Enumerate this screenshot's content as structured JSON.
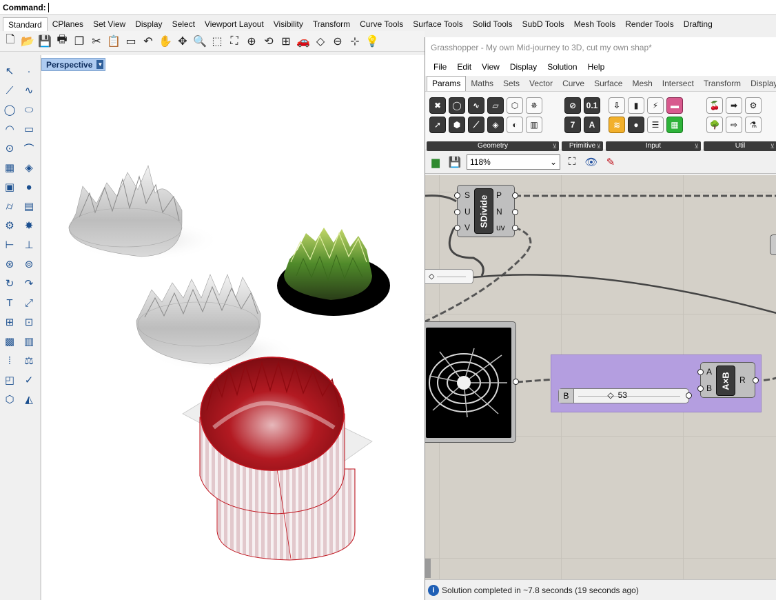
{
  "command": {
    "label": "Command:"
  },
  "tabs": [
    "Standard",
    "CPlanes",
    "Set View",
    "Display",
    "Select",
    "Viewport Layout",
    "Visibility",
    "Transform",
    "Curve Tools",
    "Surface Tools",
    "Solid Tools",
    "SubD Tools",
    "Mesh Tools",
    "Render Tools",
    "Drafting"
  ],
  "active_tab": "Standard",
  "viewport": {
    "name": "Perspective"
  },
  "grasshopper": {
    "title": "Grasshopper - My own Mid-journey to 3D, cut my own shap*",
    "menu": [
      "File",
      "Edit",
      "View",
      "Display",
      "Solution",
      "Help"
    ],
    "ribbon_tabs": [
      "Params",
      "Maths",
      "Sets",
      "Vector",
      "Curve",
      "Surface",
      "Mesh",
      "Intersect",
      "Transform",
      "Display"
    ],
    "active_ribbon_tab": "Params",
    "ribbon_groups": [
      {
        "label": "Geometry"
      },
      {
        "label": "Primitive"
      },
      {
        "label": "Input"
      },
      {
        "label": "Util"
      }
    ],
    "primitive_icons": [
      "0.1",
      "7",
      "A"
    ],
    "zoom": "118%",
    "sdivide": {
      "name": "SDivide",
      "inputs": [
        "S",
        "U",
        "V"
      ],
      "outputs": [
        "P",
        "N",
        "uv"
      ]
    },
    "mult": {
      "name": "A×B",
      "inputs": [
        "A",
        "B"
      ],
      "outputs": [
        "R"
      ]
    },
    "slider": {
      "name": "B",
      "value": "53",
      "fraction": 0.53
    },
    "status": "Solution completed in ~7.8 seconds (19 seconds ago)"
  },
  "colors": {
    "viewport_tab_bg": "#aecbf0",
    "group_purple": "#b49ee0",
    "cylinder_red": "#c0141e",
    "canvas_bg": "#d4d0c8"
  }
}
